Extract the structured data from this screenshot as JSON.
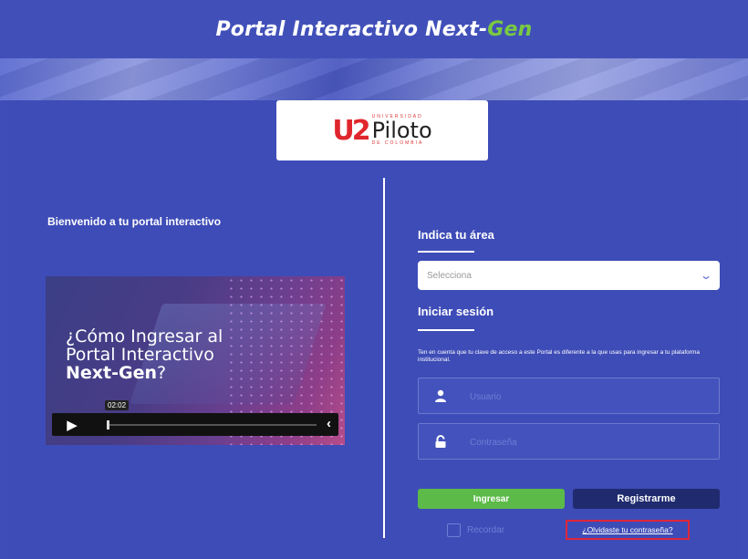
{
  "header": {
    "title_main": "Portal Interactivo Ne",
    "title_x": "x",
    "title_t": "t-",
    "title_accent": "Gen"
  },
  "logo": {
    "mark": "U2",
    "small_top": "UNIVERSIDAD",
    "name": "Piloto",
    "small_bottom": "DE COLOMBIA"
  },
  "left": {
    "welcome": "Bienvenido a tu portal interactivo",
    "video": {
      "line1": "¿Cómo Ingresar al",
      "line2": "Portal Interactivo",
      "line3_bold": "Next-Gen",
      "line3_rest": "?",
      "time": "02:02"
    }
  },
  "right": {
    "area_label": "Indica tu área",
    "select": {
      "placeholder": "Selecciona"
    },
    "login_label": "Iniciar sesión",
    "notice": "Ten en cuenta que tu clave de acceso a este Portal es diferente a la que usas para ingresar a tu plataforma institucional.",
    "user_placeholder": "Usuario",
    "password_placeholder": "Contraseña",
    "login_button": "Ingresar",
    "register_button": "Registrarme",
    "remember": "Recordar",
    "forgot": "¿Olvidaste tu contraseña?"
  },
  "colors": {
    "background": "#3f4db8",
    "accent_green": "#5cba48",
    "register_navy": "#1f2b6e",
    "highlight_red": "#e0263a"
  },
  "icons": {
    "user": "user-icon",
    "lock": "lock-icon",
    "play": "play-icon",
    "chevron": "chevron-down-icon",
    "prev": "chevron-left-icon"
  }
}
